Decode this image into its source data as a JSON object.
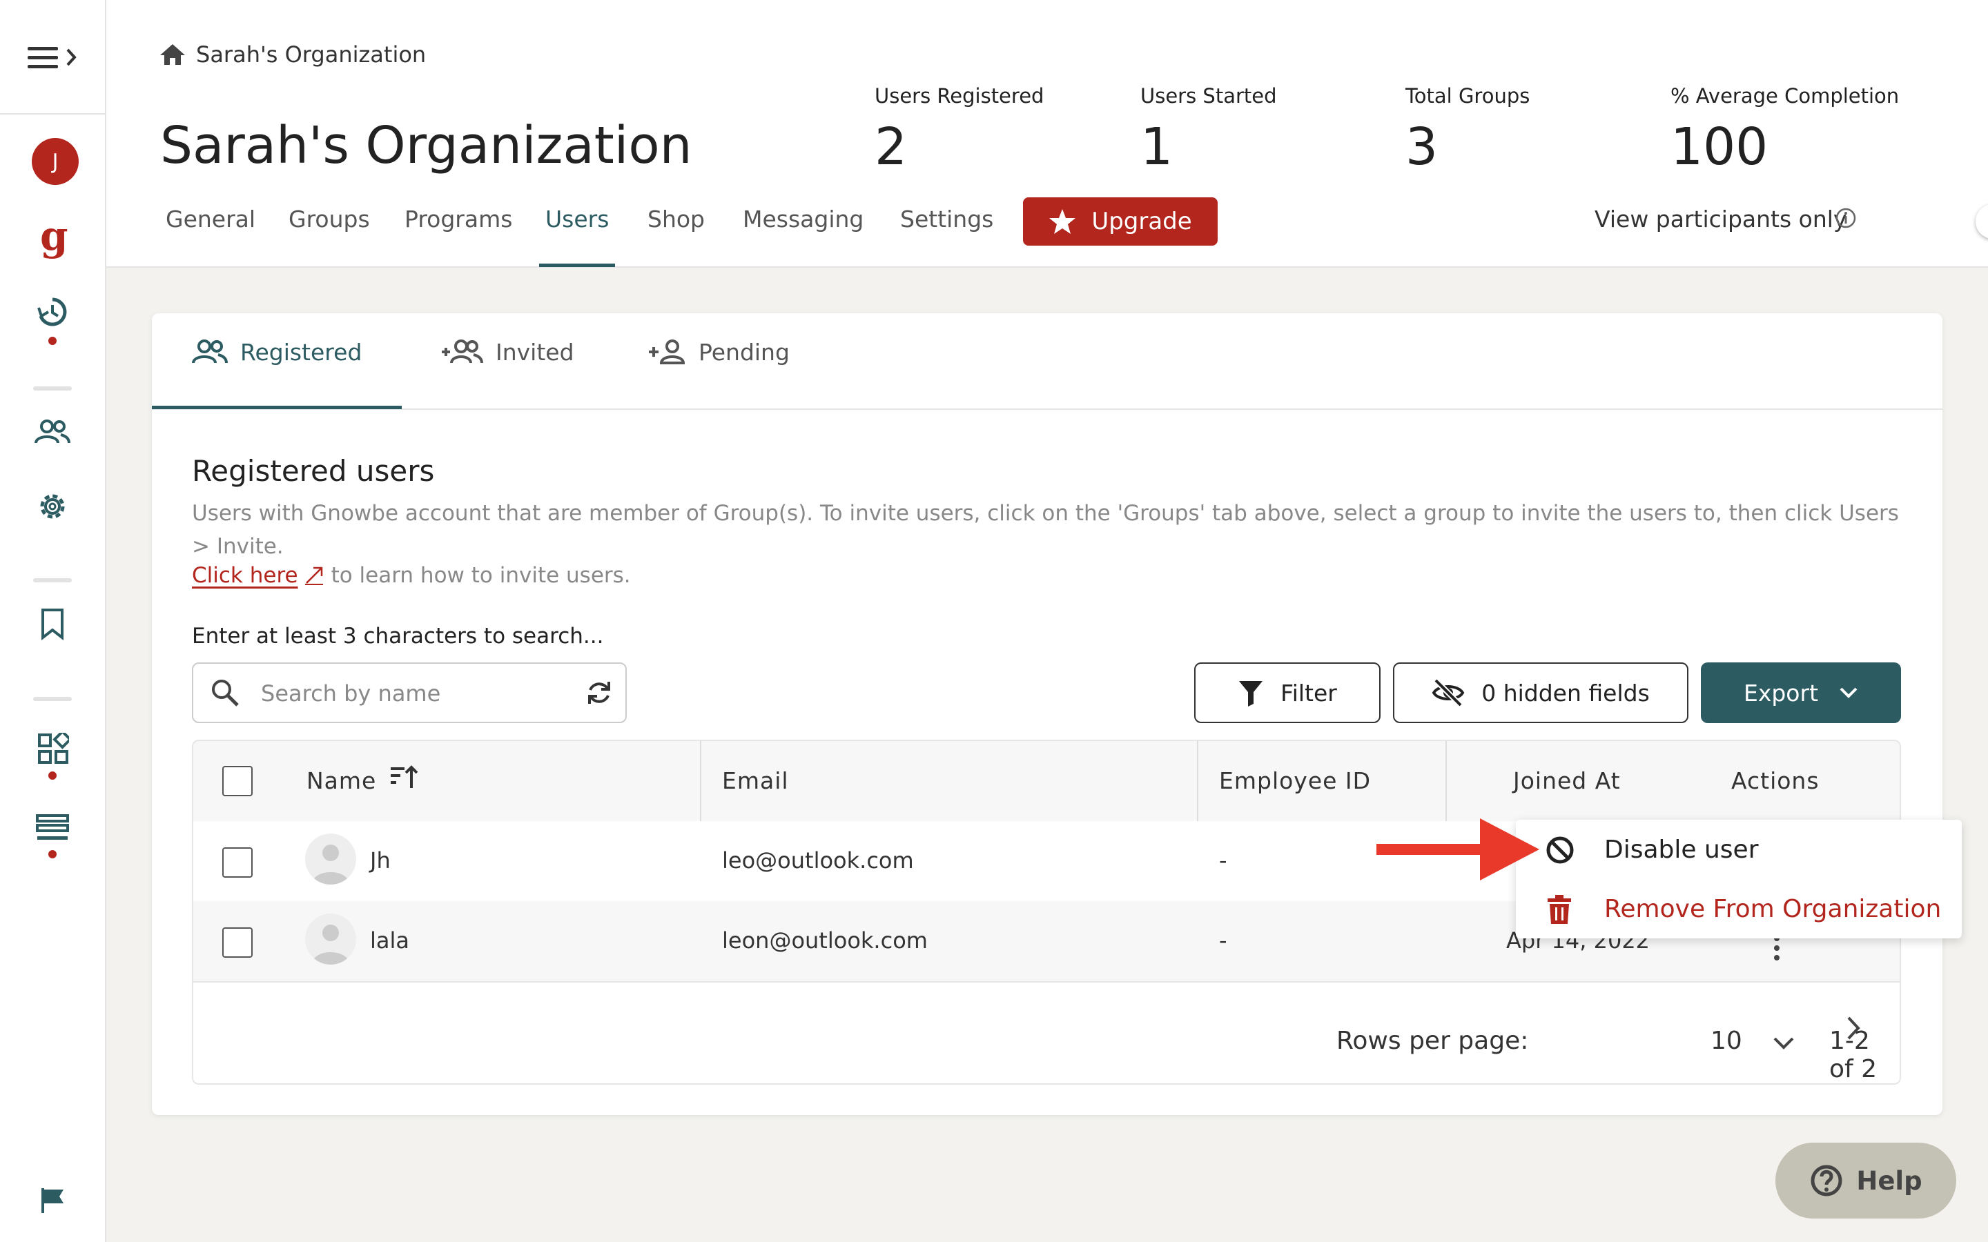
{
  "colors": {
    "brand_red": "#b3261e",
    "teal": "#2c5b62",
    "annotation_arrow": "#e8392a"
  },
  "sidebar": {
    "avatar_initial": "J",
    "logo_letter": "g",
    "icons": [
      "menu-expand-icon",
      "history-icon",
      "people-icon",
      "gear-icon",
      "bookmark-icon",
      "dashboard-icon",
      "list-icon",
      "flag-icon"
    ]
  },
  "header": {
    "breadcrumb": "Sarah's Organization",
    "title": "Sarah's Organization",
    "stats": {
      "users_registered_label": "Users Registered",
      "users_registered_value": "2",
      "users_started_label": "Users Started",
      "users_started_value": "1",
      "total_groups_label": "Total Groups",
      "total_groups_value": "3",
      "avg_completion_label": "% Average Completion",
      "avg_completion_value": "100"
    },
    "tabs": {
      "general": "General",
      "groups": "Groups",
      "programs": "Programs",
      "users": "Users",
      "shop": "Shop",
      "messaging": "Messaging",
      "settings": "Settings"
    },
    "active_tab": "Users",
    "upgrade_label": "Upgrade",
    "view_participants_label": "View participants only",
    "view_participants_on": false
  },
  "subtabs": {
    "registered": "Registered",
    "invited": "Invited",
    "pending": "Pending",
    "active": "Registered"
  },
  "section": {
    "title": "Registered users",
    "description": "Users with Gnowbe account that are member of Group(s). To invite users, click on the 'Groups' tab above, select a group to invite the users to, then click Users > Invite.",
    "link_text": "Click here",
    "link_suffix": "to learn how to invite users.",
    "search_hint": "Enter at least 3 characters to search...",
    "search_placeholder": "Search by name",
    "search_value": ""
  },
  "toolbar": {
    "filter_label": "Filter",
    "hidden_fields_label": "0 hidden fields",
    "export_label": "Export"
  },
  "table": {
    "columns": {
      "name": "Name",
      "email": "Email",
      "employee_id": "Employee ID",
      "joined_at": "Joined At",
      "actions": "Actions"
    },
    "rows": [
      {
        "name": "Jh",
        "email": "leo@outlook.com",
        "employee_id": "-",
        "joined_at": ""
      },
      {
        "name": "lala",
        "email": "leon@outlook.com",
        "employee_id": "-",
        "joined_at": "Apr 14, 2022"
      }
    ]
  },
  "pagination": {
    "rows_per_page_label": "Rows per page:",
    "rows_per_page_value": "10",
    "range": "1-2 of 2"
  },
  "action_menu": {
    "disable_label": "Disable user",
    "remove_label": "Remove From Organization"
  },
  "help": {
    "label": "Help"
  }
}
